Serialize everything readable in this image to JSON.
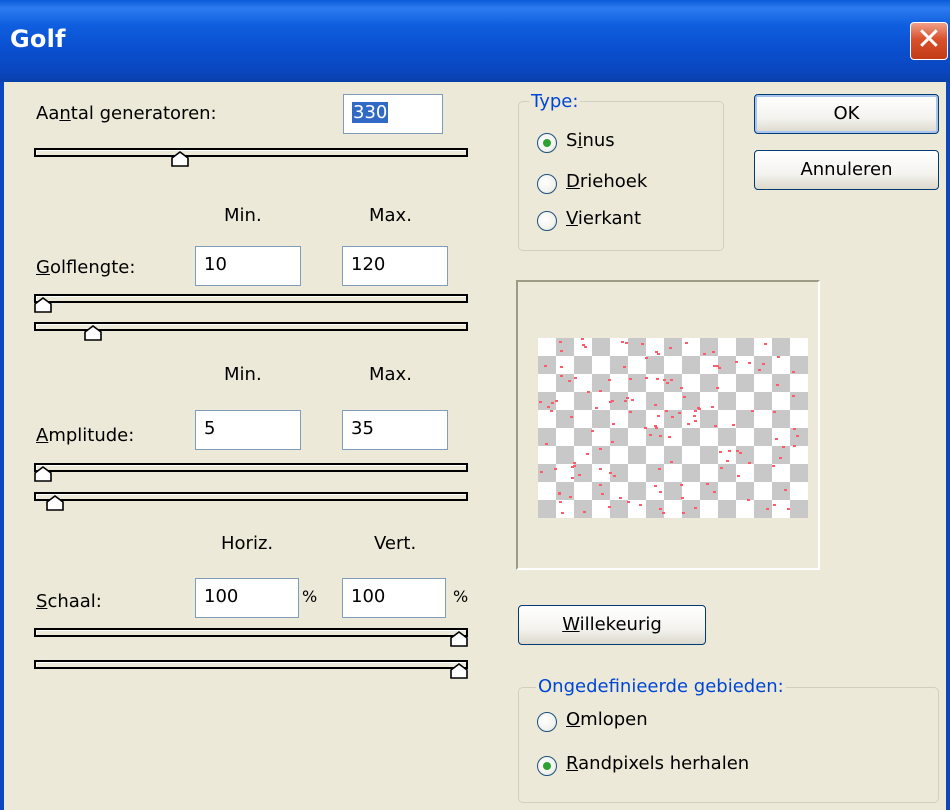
{
  "window": {
    "title": "Golf",
    "close_glyph": "✕"
  },
  "generators": {
    "label_pre": "Aa",
    "label_u": "n",
    "label_post": "tal generatoren:",
    "value": "330",
    "slider_fraction": 0.33
  },
  "wavelength": {
    "min_header": "Min.",
    "max_header": "Max.",
    "label_u": "G",
    "label_post": "olflengte:",
    "min": "10",
    "max": "120",
    "slider_min_fraction": 0.0,
    "slider_max_fraction": 0.12
  },
  "amplitude": {
    "min_header": "Min.",
    "max_header": "Max.",
    "label_u": "A",
    "label_post": "mplitude:",
    "min": "5",
    "max": "35",
    "slider_min_fraction": 0.0,
    "slider_max_fraction": 0.03
  },
  "scale": {
    "h_header": "Horiz.",
    "v_header": "Vert.",
    "label_u": "S",
    "label_post": "chaal:",
    "horiz": "100",
    "vert": "100",
    "unit": "%",
    "slider_h_fraction": 1.0,
    "slider_v_fraction": 1.0
  },
  "type_group": {
    "legend": "Type:",
    "options": [
      {
        "pre": "S",
        "u": "i",
        "post": "nus",
        "checked": true
      },
      {
        "pre": "",
        "u": "D",
        "post": "riehoek",
        "checked": false
      },
      {
        "pre": "",
        "u": "V",
        "post": "ierkant",
        "checked": false
      }
    ]
  },
  "buttons": {
    "ok": "OK",
    "cancel": "Annuleren",
    "random_u": "W",
    "random_post": "illekeurig"
  },
  "undefined_group": {
    "legend": "Ongedefinieerde gebieden:",
    "options": [
      {
        "u": "O",
        "post": "mlopen",
        "checked": false
      },
      {
        "u": "R",
        "post": "andpixels herhalen",
        "checked": true
      }
    ]
  },
  "icons": {
    "close": "close-icon",
    "radio": "radio-icon",
    "slider_thumb": "slider-thumb-icon"
  },
  "colors": {
    "titlebar": "#0a4fcf",
    "accent": "#0046d5",
    "radio_dot": "#2da232",
    "preview_dot": "#ff5a6a"
  }
}
